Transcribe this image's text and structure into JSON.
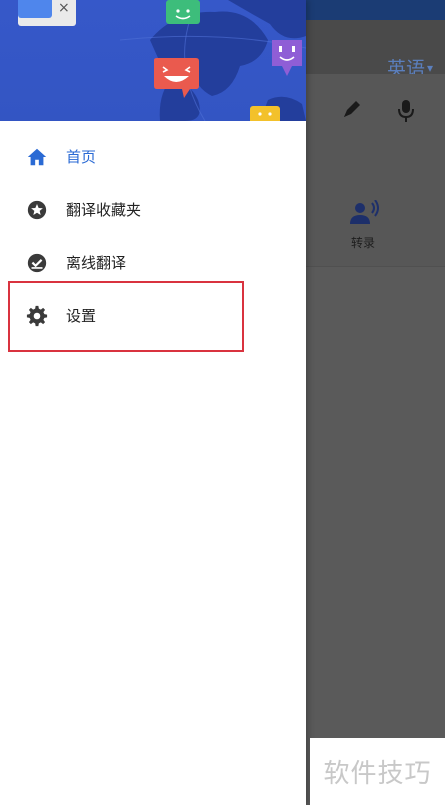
{
  "background_app": {
    "language_selector": {
      "label": "英语",
      "caret": "▾"
    },
    "tools": [
      {
        "name": "pen-icon"
      },
      {
        "name": "microphone-icon"
      }
    ],
    "transcribe": {
      "label": "转录",
      "icon": "transcribe-icon"
    }
  },
  "drawer": {
    "header_illustration": "world-map-chat-illustration",
    "items": [
      {
        "label": "首页",
        "icon": "home-icon",
        "active": true
      },
      {
        "label": "翻译收藏夹",
        "icon": "star-icon",
        "active": false
      },
      {
        "label": "离线翻译",
        "icon": "offline-check-icon",
        "active": false
      },
      {
        "label": "设置",
        "icon": "gear-icon",
        "active": false
      }
    ]
  },
  "highlight": {
    "target": "设置",
    "color": "#d9333f"
  },
  "watermark": {
    "text": "软件技巧"
  },
  "colors": {
    "accent": "#2a6ad4",
    "header_blue": "#3658c9",
    "scrim": "#5a5a5a"
  }
}
